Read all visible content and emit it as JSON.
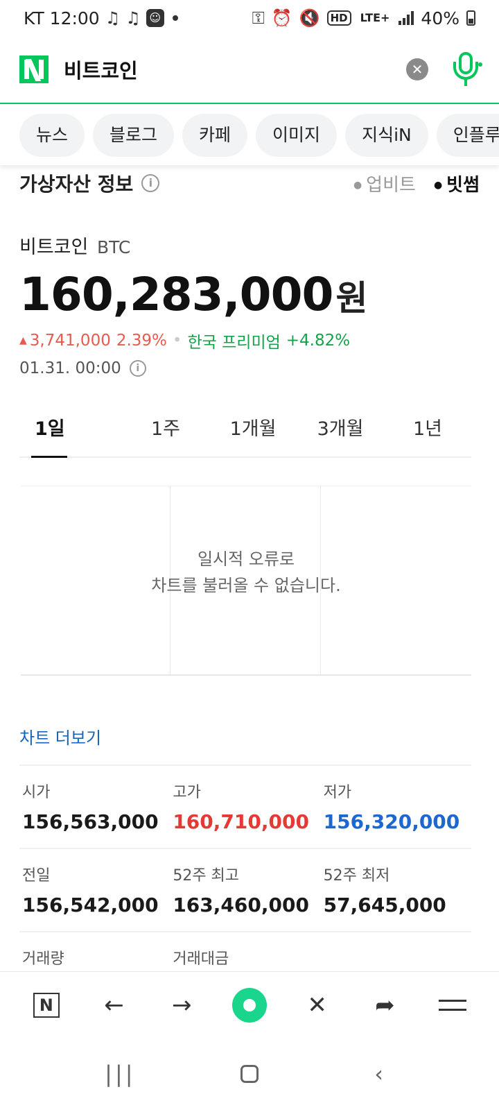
{
  "status_bar": {
    "carrier_time": "KT 12:00",
    "battery": "40%",
    "net_label": "LTE+",
    "hd_label": "HD",
    "icons": [
      "music-note-icon",
      "music-note-icon",
      "app-notification-icon",
      "dot-icon",
      "key-icon",
      "alarm-icon",
      "mute-icon",
      "hd-icon",
      "lte-icon",
      "signal-icon",
      "battery-icon"
    ]
  },
  "search": {
    "query": "비트코인",
    "logo": "N",
    "accent": "#03c75a"
  },
  "categories": [
    "뉴스",
    "블로그",
    "카페",
    "이미지",
    "지식iN",
    "인플루"
  ],
  "crypto": {
    "section_title": "가상자산 정보",
    "exchanges": [
      {
        "label": "업비트",
        "active": false
      },
      {
        "label": "빗썸",
        "active": true
      }
    ],
    "coin_name": "비트코인",
    "ticker": "BTC",
    "price": "160,283,000",
    "unit": "원",
    "change": "3,741,000",
    "change_pct": "2.39%",
    "premium_label": "한국 프리미엄",
    "premium_value": "+4.82%",
    "timestamp": "01.31. 00:00",
    "periods": [
      {
        "label": "1일",
        "active": true
      },
      {
        "label": "1주",
        "active": false
      },
      {
        "label": "1개월",
        "active": false
      },
      {
        "label": "3개월",
        "active": false
      },
      {
        "label": "1년",
        "active": false
      }
    ],
    "chart_error_line1": "일시적 오류로",
    "chart_error_line2": "차트를 불러올 수 없습니다.",
    "more_chart": "차트 더보기",
    "stats": [
      [
        {
          "label": "시가",
          "value": "156,563,000",
          "color": "#1a1a1a"
        },
        {
          "label": "고가",
          "value": "160,710,000",
          "color": "#e53935"
        },
        {
          "label": "저가",
          "value": "156,320,000",
          "color": "#1e66d0"
        }
      ],
      [
        {
          "label": "전일",
          "value": "156,542,000",
          "color": "#1a1a1a"
        },
        {
          "label": "52주 최고",
          "value": "163,460,000",
          "color": "#1a1a1a"
        },
        {
          "label": "52주 최저",
          "value": "57,645,000",
          "color": "#1a1a1a"
        }
      ],
      [
        {
          "label": "거래량",
          "value": ""
        },
        {
          "label": "거래대금",
          "value": ""
        },
        {
          "label": "",
          "value": ""
        }
      ]
    ]
  },
  "toolbar": {
    "items": [
      "naver-home-icon",
      "back-arrow-icon",
      "forward-arrow-icon",
      "green-dot-icon",
      "close-icon",
      "share-icon",
      "menu-icon"
    ],
    "home_label": "N"
  },
  "nav_bar": {
    "items": [
      "recent-apps-icon",
      "home-icon",
      "back-icon"
    ]
  }
}
